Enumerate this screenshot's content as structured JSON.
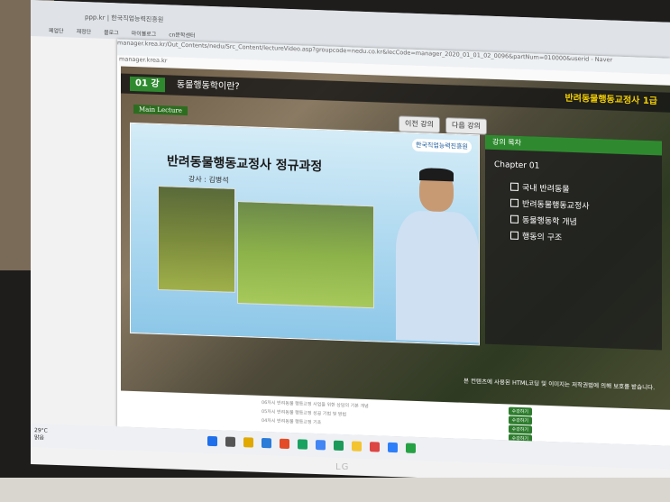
{
  "browser": {
    "address": "ppp.kr | 한국직업능력진흥원",
    "bookmarks": [
      "페업단",
      "재정단",
      "블로그",
      "마이블로그",
      "cn문학센터"
    ]
  },
  "popup": {
    "title": "manager.krea.kr/Out_Contents/nedu/Src_Content/lectureVideo.asp?groupcode=nedu.co.kr&lecCode=manager_2020_01_01_02_0096&partNum=010000&userid - Naver",
    "url": "manager.krea.kr"
  },
  "player": {
    "lesson_number": "01 강",
    "lesson_title": "동물행동학이란?",
    "course_name": "반려동물행동교정사 1급",
    "main_lecture_label": "Main Lecture",
    "prev_button": "이전 강의",
    "next_button": "다음 강의",
    "video": {
      "title": "반려동물행동교정사 정규과정",
      "teacher": "강사 : 김병석",
      "logo": "한국직업능력진흥원"
    },
    "toc": {
      "header": "강의 목차",
      "chapter": "Chapter 01",
      "items": [
        "국내 반려동물",
        "반려동물행동교정사",
        "동물행동학 개념",
        "행동의 구조"
      ]
    },
    "copyright": "본 컨텐츠에 사용된 HTML코딩 및 이미지는 저작권법에 의해 보호를 받습니다."
  },
  "list": {
    "rows": [
      {
        "text": "06차시 반려동물 행동교정 사업을 위한 상담의 기본 개념",
        "button": "수강하기"
      },
      {
        "text": "05차시 반려동물 행동교정 성공 기법 및 방법",
        "button": "수강하기"
      },
      {
        "text": "04차시 반려동물 행동교정 기초",
        "button": "수강하기"
      },
      {
        "text": "",
        "button": "수강하기"
      }
    ]
  },
  "taskbar": {
    "weather_temp": "29°C",
    "weather_desc": "맑음",
    "icon_colors": [
      "#1f6feb",
      "#555",
      "#e0a800",
      "#2b7bd8",
      "#e34c26",
      "#1aa260",
      "#4285f4",
      "#1b9a59",
      "#f4c430",
      "#d44",
      "#2d7ff9",
      "#25a244"
    ]
  },
  "device": {
    "brand": "LG"
  }
}
